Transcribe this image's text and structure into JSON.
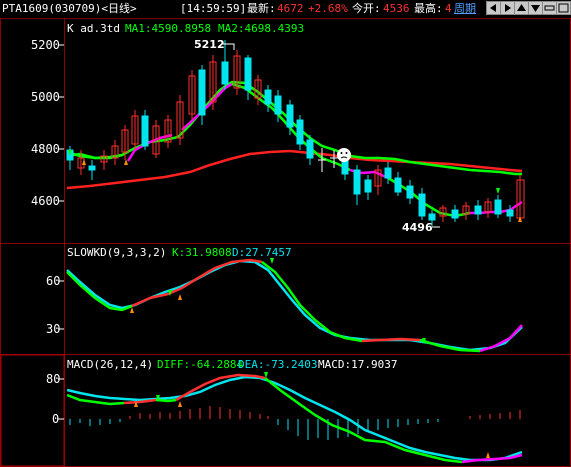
{
  "header": {
    "symbol": "PTA1609",
    "code": "(030709)",
    "period": "<日线>",
    "time": "[14:59:59]",
    "last_label": "最新:",
    "last_value": "4672",
    "change_pct": "+2.68%",
    "open_label": "今开:",
    "open_value": "4536",
    "high_label": "最高:",
    "high_value": "4",
    "period_btn": "周期"
  },
  "main_panel": {
    "title": "K  ad.3td",
    "ma1": "MA1:4590.8958",
    "ma2": "MA2:4698.4393",
    "y_ticks": [
      "5200",
      "5000",
      "4800",
      "4600"
    ],
    "peak_label": "5212",
    "trough_label": "4496"
  },
  "kd_panel": {
    "title": "SLOWKD(9,3,3,2)",
    "k": "K:31.9808",
    "d": "D:27.7457",
    "y_ticks": [
      "60",
      "30"
    ]
  },
  "macd_panel": {
    "title": "MACD(26,12,4)",
    "diff": "DIFF:-64.2884",
    "dea": "DEA:-73.2403",
    "macd": "MACD:17.9037",
    "y_ticks": [
      "80",
      "0"
    ]
  },
  "colors": {
    "up": "#ff3030",
    "down": "#00e5ee",
    "ma_fast_up": "#ff00ff",
    "ma_fast_down": "#00ff00",
    "ma_slow": "#ff2020",
    "panel_border": "#8b0000",
    "green_text": "#00ff00",
    "change_text": "#ff3030",
    "blue_text": "#4fa0ff"
  },
  "icons": [
    "left-arrow-icon",
    "right-arrow-icon",
    "up-arrow-icon",
    "down-arrow-icon",
    "zoom-out-icon",
    "zoom-in-icon"
  ]
}
